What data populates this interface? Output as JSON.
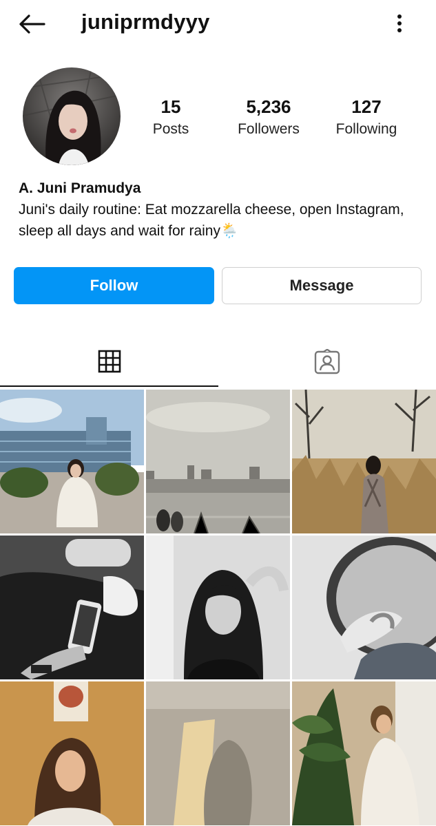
{
  "header": {
    "username": "juniprmdyyy"
  },
  "stats": [
    {
      "value": "15",
      "label": "Posts"
    },
    {
      "value": "5,236",
      "label": "Followers"
    },
    {
      "value": "127",
      "label": "Following"
    }
  ],
  "bio": {
    "name": "A. Juni Pramudya",
    "text": "Juni's daily routine: Eat mozzarella cheese, open Instagram, sleep all days and wait for rainy🌦️"
  },
  "actions": {
    "follow_label": "Follow",
    "message_label": "Message"
  },
  "tabs": [
    {
      "icon": "grid-icon",
      "active": true
    },
    {
      "icon": "tagged-person-icon",
      "active": false
    }
  ],
  "colors": {
    "follow": "#0395f6",
    "text": "#111111"
  }
}
